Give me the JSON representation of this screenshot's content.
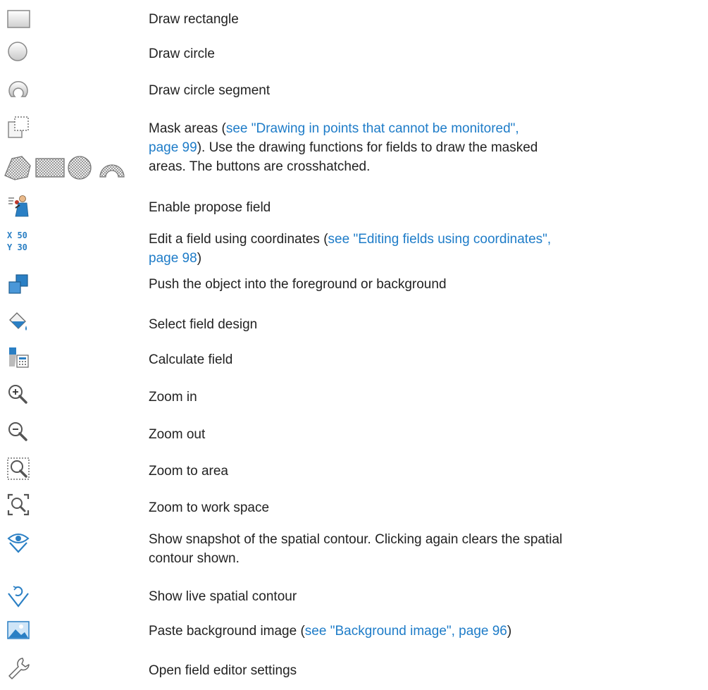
{
  "colors": {
    "link": "#1e7cc8",
    "text": "#222222",
    "icon_blue": "#2a7fc4"
  },
  "rows": [
    {
      "icon": "draw-rectangle-icon",
      "text": "Draw rectangle"
    },
    {
      "icon": "draw-circle-icon",
      "text": "Draw circle"
    },
    {
      "icon": "draw-circle-segment-icon",
      "text": "Draw circle segment"
    },
    {
      "icon": "mask-areas-icon",
      "text_before": "Mask areas (",
      "link1": "see \"Drawing in points that cannot be monitored\",",
      "link2": "page 99",
      "text_after": "). Use the drawing functions for fields to draw the masked",
      "line3": "areas. The buttons are crosshatched."
    },
    {
      "icon": "enable-propose-field-icon",
      "text": "Enable propose field"
    },
    {
      "icon": "edit-coordinates-icon",
      "text_before": "Edit a field using coordinates (",
      "link1": "see \"Editing fields using coordinates\",",
      "link2": "page 98",
      "text_after": ")",
      "icon_x_label": "X 50",
      "icon_y_label": "Y 30"
    },
    {
      "icon": "bring-to-front-icon",
      "text": "Push the object into the foreground or background"
    },
    {
      "icon": "fill-bucket-icon",
      "text": "Select field design"
    },
    {
      "icon": "calculate-field-icon",
      "text": "Calculate field"
    },
    {
      "icon": "zoom-in-icon",
      "text": "Zoom in"
    },
    {
      "icon": "zoom-out-icon",
      "text": "Zoom out"
    },
    {
      "icon": "zoom-area-icon",
      "text": "Zoom to area"
    },
    {
      "icon": "zoom-workspace-icon",
      "text": "Zoom to work space"
    },
    {
      "icon": "spatial-contour-snapshot-icon",
      "line1": "Show snapshot of the spatial contour. Clicking again clears the spatial",
      "line2": "contour shown."
    },
    {
      "icon": "live-spatial-contour-icon",
      "text": "Show live spatial contour"
    },
    {
      "icon": "background-image-icon",
      "text_before": "Paste background image (",
      "link": "see \"Background image\", page 96",
      "text_after": ")"
    },
    {
      "icon": "wrench-icon",
      "text": "Open field editor settings"
    }
  ]
}
